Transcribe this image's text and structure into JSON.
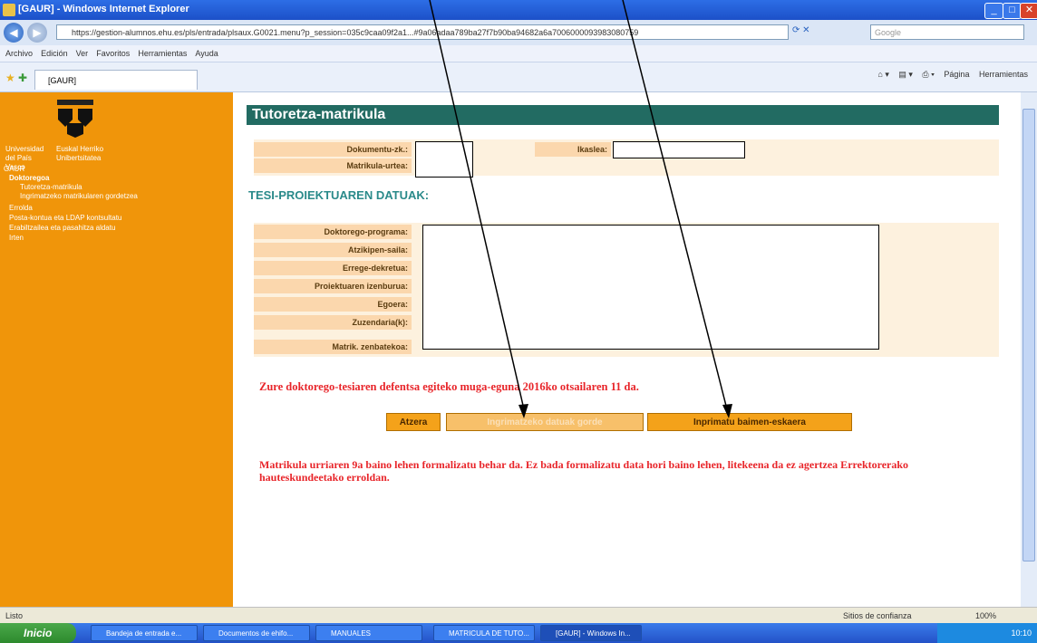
{
  "window": {
    "title": "[GAUR] - Windows Internet Explorer"
  },
  "address": {
    "url": "https://gestion-alumnos.ehu.es/pls/entrada/plsaux.G0021.menu?p_session=035c9caa09f2a1...#9a06adaa789ba27f7b90ba94682a6a7006000093983080759"
  },
  "search": {
    "placeholder": "Google"
  },
  "menu": [
    "Archivo",
    "Edición",
    "Ver",
    "Favoritos",
    "Herramientas",
    "Ayuda"
  ],
  "tab": {
    "label": "[GAUR]"
  },
  "toolbar": {
    "page": "Página",
    "tools": "Herramientas"
  },
  "sidebar": {
    "univ_es": "Universidad del País Vasco",
    "univ_eu": "Euskal Herriko Unibertsitatea",
    "tree": [
      "GAUR",
      "Doktoregoa",
      "Tutoretza-matrikula",
      "Ingrimatzeko matrikularen gordetzea",
      "Errolda",
      "Posta-kontua eta LDAP kontsultatu",
      "Erabiltzailea eta pasahitza aldatu",
      "Irten"
    ]
  },
  "page": {
    "title": "Tutoretza-matrikula",
    "doc_label": "Dokumentu-zk.:",
    "ikaslea_label": "Ikaslea:",
    "matrik_label": "Matrikula-urtea:",
    "section": "TESI-PROIEKTUAREN DATUAK:",
    "fields": [
      "Doktorego-programa:",
      "Atzikipen-saila:",
      "Errege-dekretua:",
      "Proiektuaren izenburua:",
      "Egoera:",
      "Zuzendaria(k):",
      "Matrik. zenbatekoa:"
    ],
    "deadline": "Zure doktorego-tesiaren defentsa egiteko muga-eguna 2016ko otsailaren 11 da.",
    "buttons": {
      "back": "Atzera",
      "save": "Ingrimatzeko datuak gorde",
      "print": "Inprimatu baimen-eskaera"
    },
    "notice": "Matrikula urriaren 9a baino lehen formalizatu behar da. Ez bada formalizatu data hori baino lehen, litekeena da ez agertzea Errektorerako hauteskundeetako erroldan."
  },
  "status": {
    "left": "Listo",
    "zone": "Sitios de confianza",
    "zoom": "100%"
  },
  "taskbar": {
    "start": "Inicio",
    "items": [
      "Bandeja de entrada e...",
      "Documentos de ehifo...",
      "MANUALES",
      "MATRICULA DE TUTO...",
      "[GAUR] - Windows In..."
    ],
    "clock": "10:10"
  }
}
